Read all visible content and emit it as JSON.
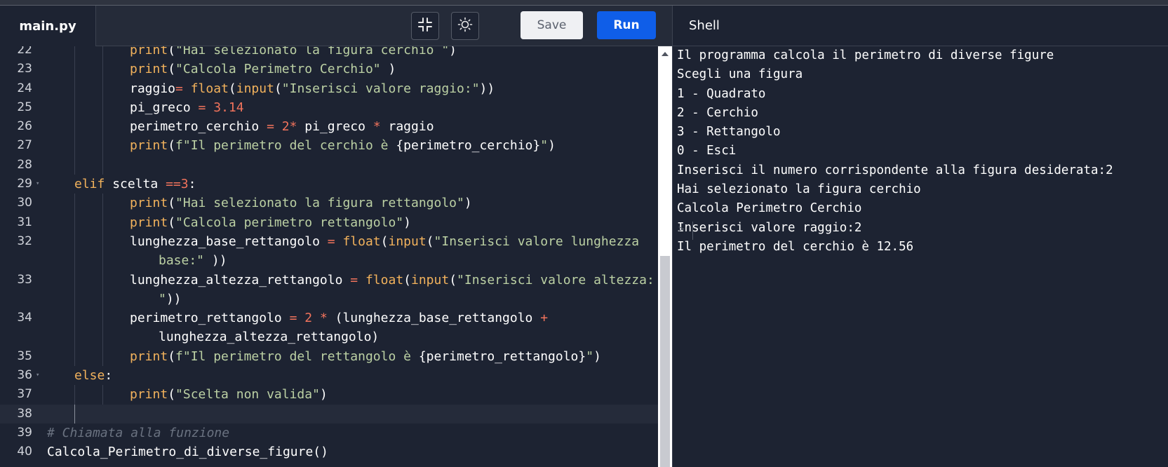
{
  "editor": {
    "file_tab": "main.py",
    "toolbar": {
      "collapse_icon": "collapse-icon",
      "theme_icon": "sun-icon",
      "save_label": "Save",
      "run_label": "Run"
    },
    "lines": [
      {
        "n": "22",
        "tokens": [
          [
            "kw",
            "print"
          ],
          [
            "plain",
            "("
          ],
          [
            "str",
            "\"Hai selezionato la figura cerchio \""
          ],
          [
            "plain",
            ")"
          ]
        ]
      },
      {
        "n": "23",
        "tokens": [
          [
            "kw",
            "print"
          ],
          [
            "plain",
            "("
          ],
          [
            "str",
            "\"Calcola Perimetro Cerchio\""
          ],
          [
            "plain",
            " )"
          ]
        ]
      },
      {
        "n": "24",
        "tokens": [
          [
            "plain",
            "raggio"
          ],
          [
            "op",
            "="
          ],
          [
            "plain",
            " "
          ],
          [
            "kw",
            "float"
          ],
          [
            "plain",
            "("
          ],
          [
            "kw",
            "input"
          ],
          [
            "plain",
            "("
          ],
          [
            "str",
            "\"Inserisci valore raggio:\""
          ],
          [
            "plain",
            "))"
          ]
        ]
      },
      {
        "n": "25",
        "tokens": [
          [
            "plain",
            "pi_greco "
          ],
          [
            "op",
            "="
          ],
          [
            "plain",
            " "
          ],
          [
            "num",
            "3.14"
          ]
        ]
      },
      {
        "n": "26",
        "tokens": [
          [
            "plain",
            "perimetro_cerchio "
          ],
          [
            "op",
            "="
          ],
          [
            "plain",
            " "
          ],
          [
            "num",
            "2"
          ],
          [
            "op",
            "*"
          ],
          [
            "plain",
            " pi_greco "
          ],
          [
            "op",
            "*"
          ],
          [
            "plain",
            " raggio"
          ]
        ]
      },
      {
        "n": "27",
        "tokens": [
          [
            "kw",
            "print"
          ],
          [
            "plain",
            "("
          ],
          [
            "str",
            "f\"Il perimetro del cerchio è "
          ],
          [
            "plain",
            "{perimetro_cerchio}"
          ],
          [
            "str",
            "\""
          ],
          [
            "plain",
            ")"
          ]
        ]
      },
      {
        "n": "28",
        "tokens": []
      },
      {
        "n": "29",
        "tokens": [
          [
            "kw",
            "elif"
          ],
          [
            "plain",
            " scelta "
          ],
          [
            "op",
            "=="
          ],
          [
            "num",
            "3"
          ],
          [
            "plain",
            ":"
          ]
        ]
      },
      {
        "n": "30",
        "tokens": [
          [
            "kw",
            "print"
          ],
          [
            "plain",
            "("
          ],
          [
            "str",
            "\"Hai selezionato la figura rettangolo\""
          ],
          [
            "plain",
            ")"
          ]
        ]
      },
      {
        "n": "31",
        "tokens": [
          [
            "kw",
            "print"
          ],
          [
            "plain",
            "("
          ],
          [
            "str",
            "\"Calcola perimetro rettangolo\""
          ],
          [
            "plain",
            ")"
          ]
        ]
      },
      {
        "n": "32",
        "tokens": [
          [
            "plain",
            "lunghezza_base_rettangolo "
          ],
          [
            "op",
            "="
          ],
          [
            "plain",
            " "
          ],
          [
            "kw",
            "float"
          ],
          [
            "plain",
            "("
          ],
          [
            "kw",
            "input"
          ],
          [
            "plain",
            "("
          ],
          [
            "str",
            "\"Inserisci valore lunghezza"
          ]
        ],
        "cont": [
          [
            "str",
            "base:\""
          ],
          [
            "plain",
            " ))"
          ]
        ]
      },
      {
        "n": "33",
        "tokens": [
          [
            "plain",
            "lunghezza_altezza_rettangolo "
          ],
          [
            "op",
            "="
          ],
          [
            "plain",
            " "
          ],
          [
            "kw",
            "float"
          ],
          [
            "plain",
            "("
          ],
          [
            "kw",
            "input"
          ],
          [
            "plain",
            "("
          ],
          [
            "str",
            "\"Inserisci valore altezza:"
          ]
        ],
        "cont": [
          [
            "str",
            "\""
          ],
          [
            "plain",
            "))"
          ]
        ]
      },
      {
        "n": "34",
        "tokens": [
          [
            "plain",
            "perimetro_rettangolo "
          ],
          [
            "op",
            "="
          ],
          [
            "plain",
            " "
          ],
          [
            "num",
            "2"
          ],
          [
            "plain",
            " "
          ],
          [
            "op",
            "*"
          ],
          [
            "plain",
            " (lunghezza_base_rettangolo "
          ],
          [
            "op",
            "+"
          ]
        ],
        "cont": [
          [
            "plain",
            "lunghezza_altezza_rettangolo)"
          ]
        ]
      },
      {
        "n": "35",
        "tokens": [
          [
            "kw",
            "print"
          ],
          [
            "plain",
            "("
          ],
          [
            "str",
            "f\"Il perimetro del rettangolo è "
          ],
          [
            "plain",
            "{perimetro_rettangolo}"
          ],
          [
            "str",
            "\""
          ],
          [
            "plain",
            ")"
          ]
        ]
      },
      {
        "n": "36",
        "tokens": [
          [
            "kw",
            "else"
          ],
          [
            "plain",
            ":"
          ]
        ]
      },
      {
        "n": "37",
        "tokens": [
          [
            "kw",
            "print"
          ],
          [
            "plain",
            "("
          ],
          [
            "str",
            "\"Scelta non valida\""
          ],
          [
            "plain",
            ")"
          ]
        ]
      },
      {
        "n": "38",
        "tokens": []
      },
      {
        "n": "39",
        "tokens": [
          [
            "cm",
            "# Chiamata alla funzione"
          ]
        ]
      },
      {
        "n": "40",
        "tokens": [
          [
            "plain",
            "Calcola_Perimetro_di_diverse_figure()"
          ]
        ]
      }
    ]
  },
  "shell": {
    "title": "Shell",
    "output": [
      "Il programma calcola il perimetro di diverse figure",
      "Scegli una figura",
      "1 - Quadrato",
      "2 - Cerchio",
      "3 - Rettangolo",
      "0 - Esci",
      "Inserisci il numero corrispondente alla figura desiderata:2",
      "Hai selezionato la figura cerchio",
      "Calcola Perimetro Cerchio",
      "Inserisci valore raggio:2",
      "Il perimetro del cerchio è 12.56"
    ],
    "prompt": ">"
  },
  "colors": {
    "background": "#1d2332",
    "keyword": "#f2b25c",
    "string": "#bcd1a4",
    "number": "#f1735c",
    "comment": "#6a7280",
    "run_button": "#0f5ee8"
  }
}
